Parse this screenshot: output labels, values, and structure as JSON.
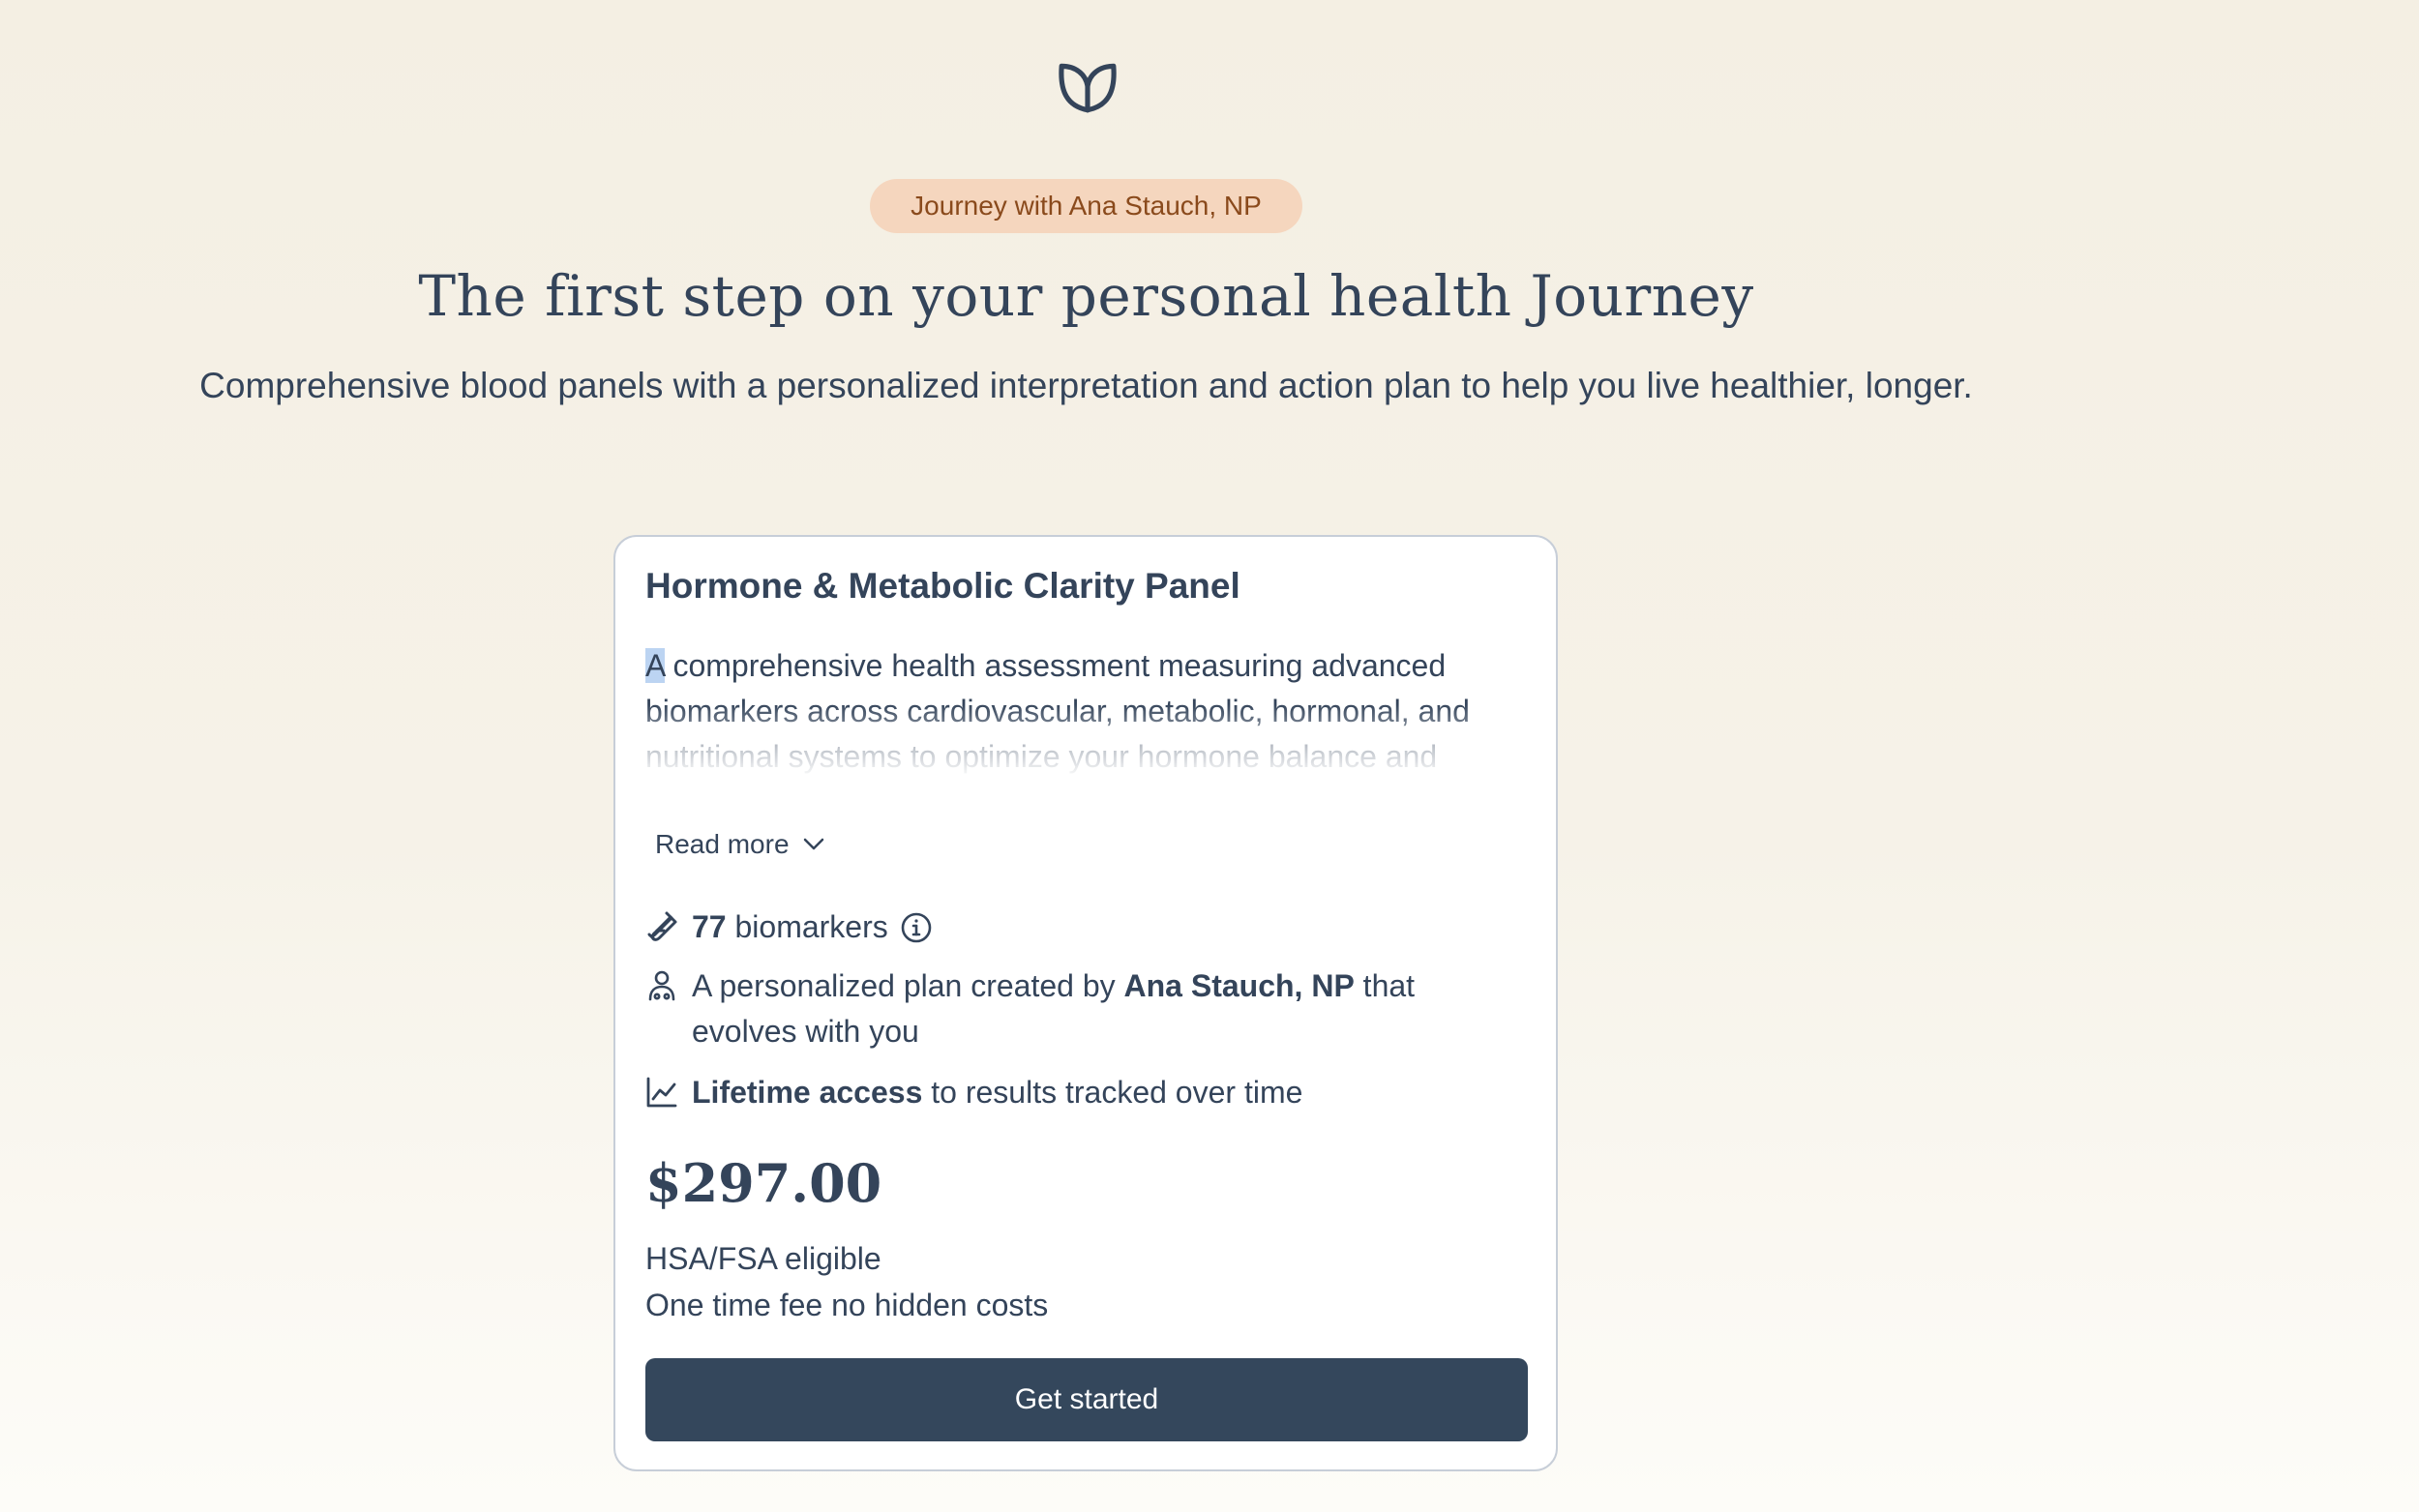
{
  "header": {
    "logo_icon": "leaf-heart-icon",
    "badge": "Journey with Ana Stauch, NP",
    "title": "The first step on your personal health Journey",
    "subtitle": "Comprehensive blood panels with a personalized interpretation and action plan to help you live healthier, longer."
  },
  "card": {
    "title": "Hormone & Metabolic Clarity Panel",
    "description_first": "A",
    "description_rest": " comprehensive health assessment measuring advanced biomarkers across cardiovascular, metabolic, hormonal, and nutritional systems to optimize your hormone balance and health.",
    "read_more": "Read more",
    "features": {
      "biomarkers": {
        "icon": "test-tube-icon",
        "count": "77",
        "text": "biomarkers",
        "info_icon": "info-icon"
      },
      "plan": {
        "icon": "person-icon",
        "pre": "A personalized plan created by ",
        "bold": "Ana Stauch, NP",
        "post": " that evolves with you"
      },
      "access": {
        "icon": "line-chart-icon",
        "bold": "Lifetime access",
        "post": " to results tracked over time"
      }
    },
    "price": "$297.00",
    "notes": [
      "HSA/FSA eligible",
      "One time fee no hidden costs"
    ],
    "cta": "Get started"
  },
  "colors": {
    "background": "#f4efe3",
    "text": "#34445a",
    "badge_bg": "#f5d6be",
    "badge_text": "#8a4a1c",
    "button": "#34475c",
    "card_border": "#c7ced8"
  }
}
